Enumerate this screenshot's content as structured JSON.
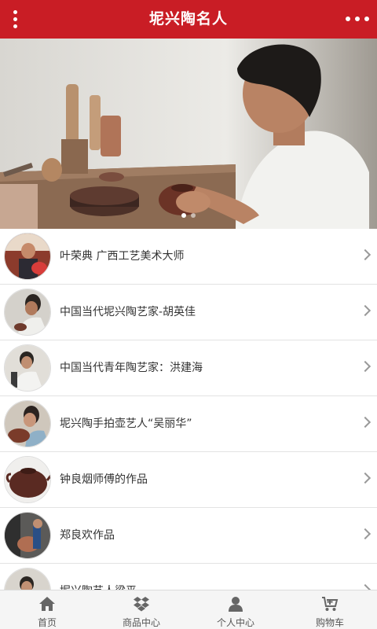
{
  "header": {
    "title": "坭兴陶名人"
  },
  "banner": {
    "slides": 2,
    "active_slide": 1
  },
  "list": [
    {
      "label": "叶荣典 广西工艺美术大师"
    },
    {
      "label": "中国当代坭兴陶艺家-胡英佳"
    },
    {
      "label": "中国当代青年陶艺家：洪建海"
    },
    {
      "label": "坭兴陶手拍壶艺人“吴丽华”"
    },
    {
      "label": "钟良烟师傅的作品"
    },
    {
      "label": "郑良欢作品"
    },
    {
      "label": "坭兴陶艺人梁平"
    }
  ],
  "tabbar": {
    "items": [
      {
        "label": "首页",
        "icon": "home-icon"
      },
      {
        "label": "商品中心",
        "icon": "dropbox-icon"
      },
      {
        "label": "个人中心",
        "icon": "user-icon"
      },
      {
        "label": "购物车",
        "icon": "cart-icon"
      }
    ]
  },
  "colors": {
    "header_bg": "#c91d25",
    "tab_icon": "#666666"
  }
}
